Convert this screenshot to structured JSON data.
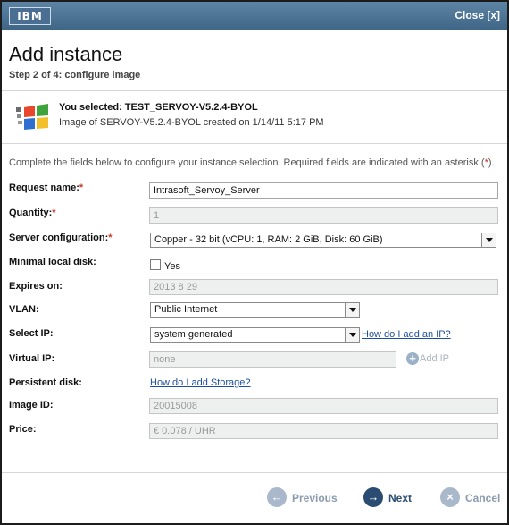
{
  "titlebar": {
    "logo": "IBM",
    "close": "Close [x]"
  },
  "page": {
    "title": "Add instance",
    "step": "Step 2 of 4: configure image"
  },
  "selection": {
    "selected": "You selected: TEST_SERVOY-V5.2.4-BYOL",
    "created": "Image of SERVOY-V5.2.4-BYOL created on 1/14/11 5:17 PM"
  },
  "intro": {
    "text": "Complete the fields below to configure your instance selection. Required fields are indicated with an asterisk (",
    "asterisk": "*",
    "tail": ")."
  },
  "form": {
    "request_name": {
      "label": "Request name:",
      "req": "*",
      "value": "Intrasoft_Servoy_Server"
    },
    "quantity": {
      "label": "Quantity:",
      "req": "*",
      "value": "1"
    },
    "server_config": {
      "label": "Server configuration:",
      "req": "*",
      "value": "Copper - 32 bit (vCPU: 1, RAM: 2 GiB, Disk: 60 GiB)"
    },
    "minimal_disk": {
      "label": "Minimal local disk:",
      "option": "Yes"
    },
    "expires": {
      "label": "Expires on:",
      "value": "2013 8 29"
    },
    "vlan": {
      "label": "VLAN:",
      "value": "Public Internet"
    },
    "select_ip": {
      "label": "Select IP:",
      "value": "system generated",
      "help": "How do I add an IP?"
    },
    "virtual_ip": {
      "label": "Virtual IP:",
      "value": "none",
      "add": "Add IP"
    },
    "persistent_disk": {
      "label": "Persistent disk:",
      "help": "How do I add Storage?"
    },
    "image_id": {
      "label": "Image ID:",
      "value": "20015008"
    },
    "price": {
      "label": "Price:",
      "value": "€ 0.078 / UHR"
    }
  },
  "footer": {
    "previous": "Previous",
    "next": "Next",
    "cancel": "Cancel"
  }
}
